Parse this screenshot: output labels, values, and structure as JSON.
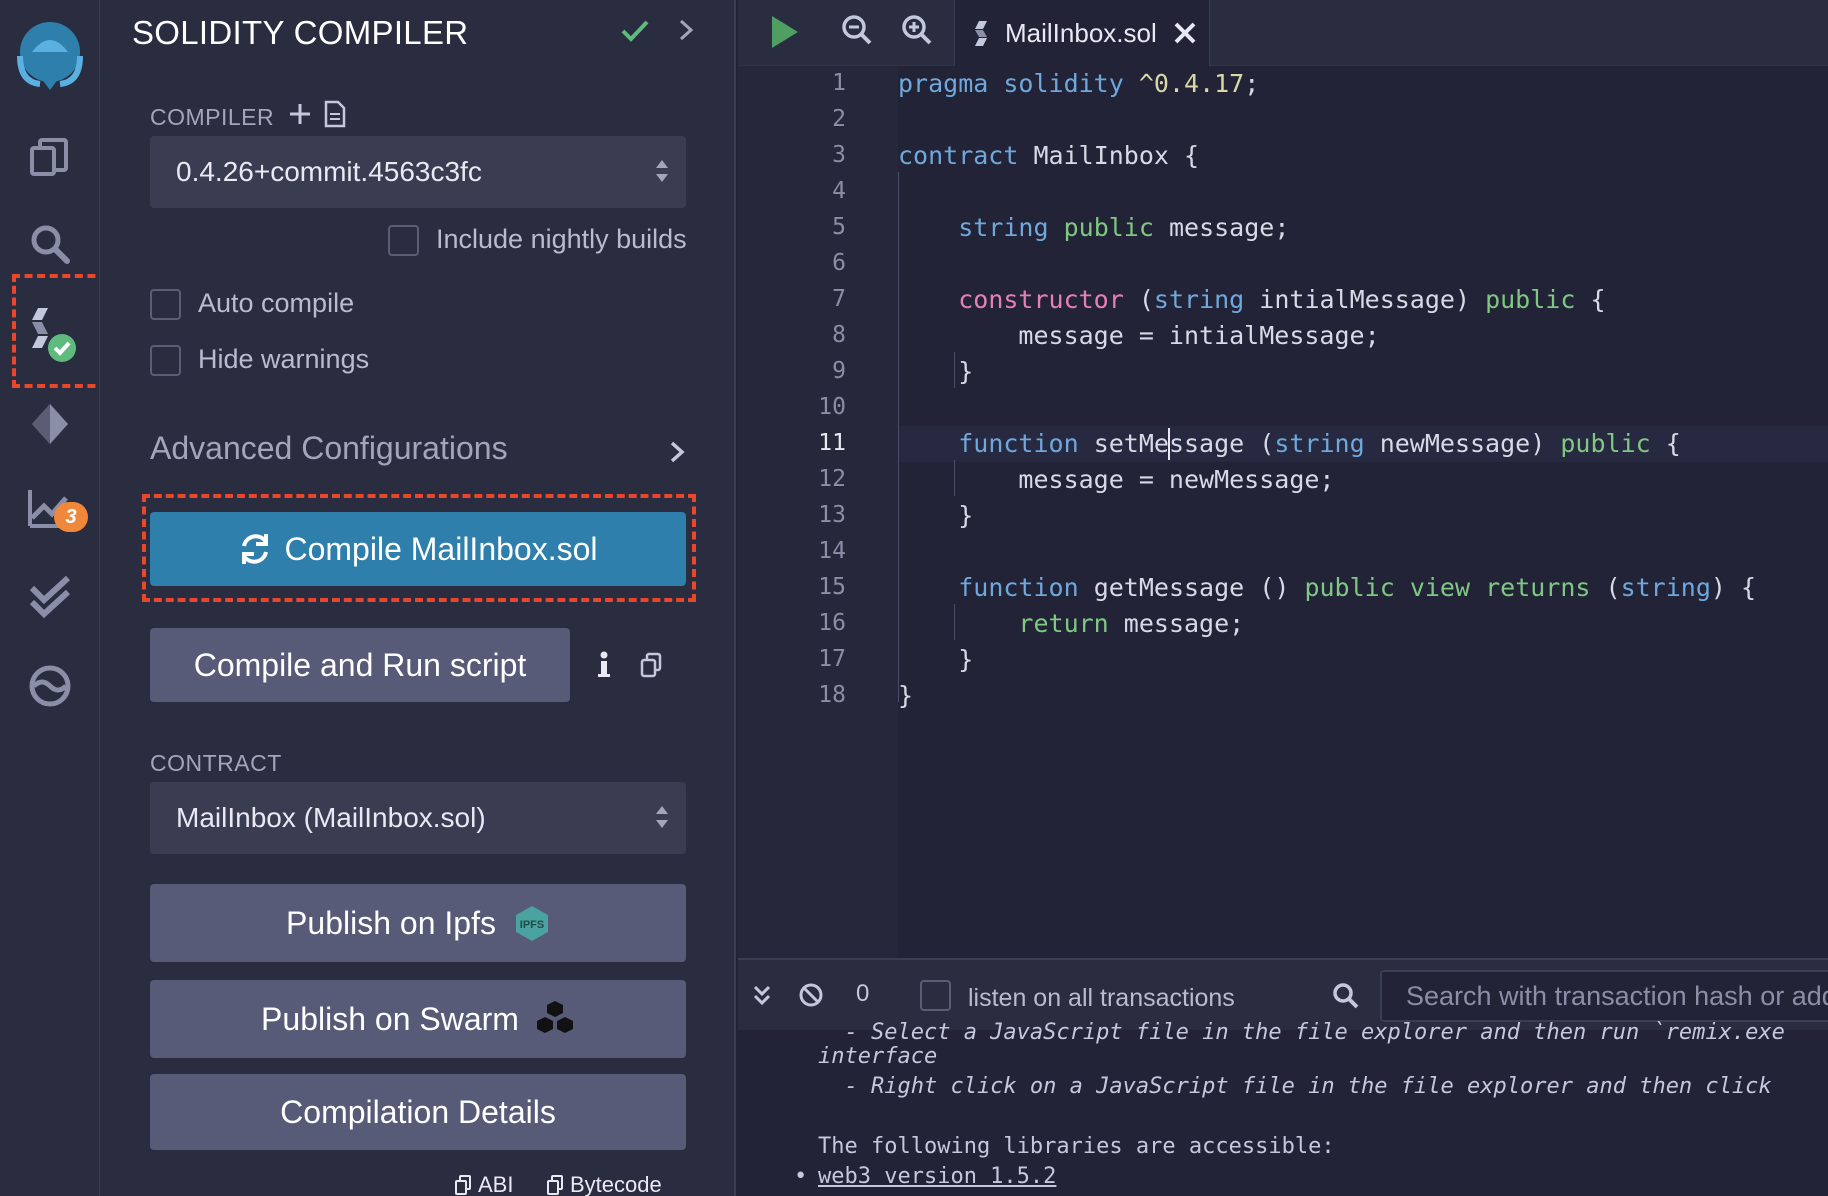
{
  "panel": {
    "title": "SOLIDITY COMPILER",
    "compiler_label": "COMPILER",
    "compiler_version": "0.4.26+commit.4563c3fc",
    "nightly_label": "Include nightly builds",
    "auto_compile_label": "Auto compile",
    "hide_warnings_label": "Hide warnings",
    "advanced_label": "Advanced Configurations",
    "compile_button": "Compile MailInbox.sol",
    "run_script_button": "Compile and Run script",
    "contract_label": "CONTRACT",
    "contract_value": "MailInbox (MailInbox.sol)",
    "ipfs_button": "Publish on Ipfs",
    "ipfs_logo_text": "IPFS",
    "swarm_button": "Publish on Swarm",
    "details_button": "Compilation Details",
    "abi_link": "ABI",
    "bytecode_link": "Bytecode"
  },
  "rail": {
    "analysis_badge": "3"
  },
  "editor": {
    "tab_name": "MailInbox.sol",
    "line_numbers": [
      "1",
      "2",
      "3",
      "4",
      "5",
      "6",
      "7",
      "8",
      "9",
      "10",
      "11",
      "12",
      "13",
      "14",
      "15",
      "16",
      "17",
      "18"
    ]
  },
  "terminal": {
    "pending_count": "0",
    "listen_label": "listen on all transactions",
    "search_placeholder": "Search with transaction hash or address",
    "lines": [
      "  - Select a JavaScript file in the file explorer and then run `remix.exe",
      "interface",
      "  - Right click on a JavaScript file in the file explorer and then click",
      "The following libraries are accessible:",
      "web3 version 1.5.2"
    ]
  },
  "colors": {
    "accent": "#2f7fad",
    "highlight": "#e8472c",
    "success": "#5fba7d",
    "badge": "#f0883b"
  }
}
